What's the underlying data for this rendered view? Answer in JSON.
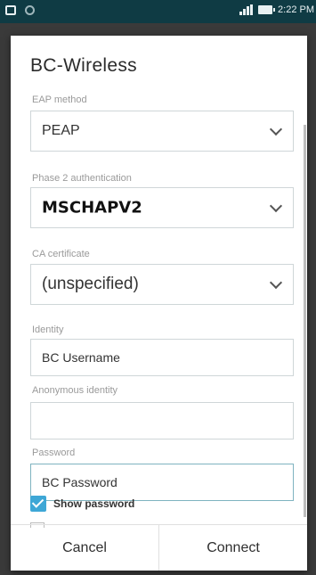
{
  "status_bar": {
    "time": "2:22 PM",
    "icons": [
      "notification-square-icon",
      "sync-circle-icon",
      "signal-icon",
      "battery-icon"
    ]
  },
  "dialog": {
    "title": "BC-Wireless",
    "fields": {
      "eap_method": {
        "label": "EAP method",
        "value": "PEAP"
      },
      "phase2": {
        "label": "Phase 2 authentication",
        "value": "MSCHAPV2"
      },
      "ca_cert": {
        "label": "CA certificate",
        "value": "(unspecified)"
      },
      "identity": {
        "label": "Identity",
        "value": "BC Username"
      },
      "anon_identity": {
        "label": "Anonymous identity",
        "value": ""
      },
      "password": {
        "label": "Password",
        "value": "BC Password"
      }
    },
    "show_password": {
      "label": "Show password",
      "checked": true
    },
    "buttons": {
      "cancel": "Cancel",
      "connect": "Connect"
    }
  },
  "colors": {
    "status_bar_bg": "#0f3b44",
    "checkbox_accent": "#3ea7d6",
    "focused_border": "#7fb3c0"
  }
}
